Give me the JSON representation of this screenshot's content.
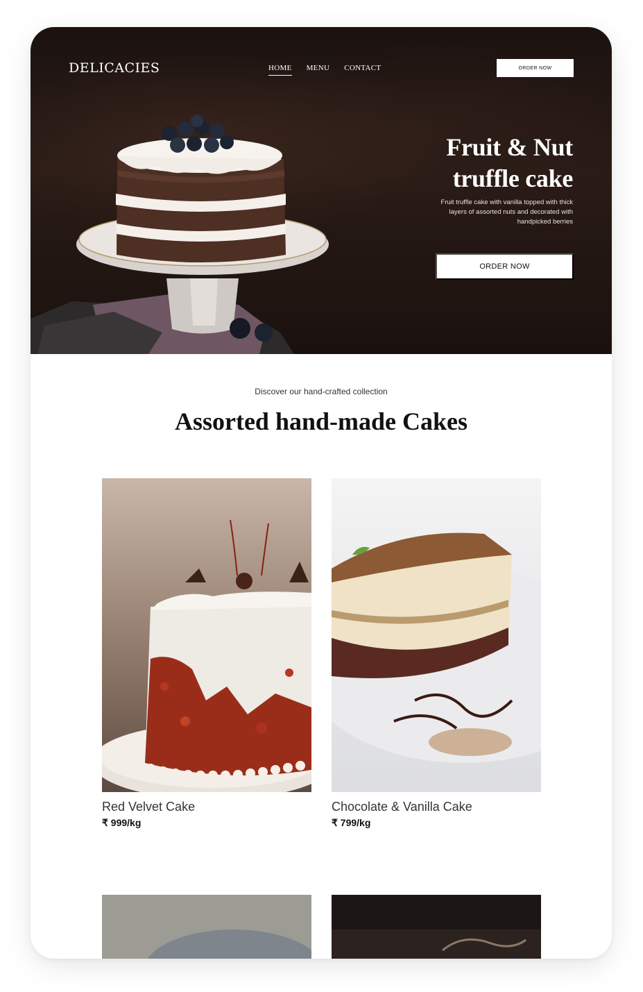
{
  "brand": {
    "logo": "DELICACIES"
  },
  "nav": {
    "items": [
      {
        "label": "HOME",
        "active": true
      },
      {
        "label": "MENU",
        "active": false
      },
      {
        "label": "CONTACT",
        "active": false
      }
    ],
    "order_button": "ORDER NOW"
  },
  "hero": {
    "title_line1": "Fruit & Nut",
    "title_line2": "truffle cake",
    "description": "Fruit truffle cake with vanilla topped with thick layers of assorted nuts and decorated with handpicked berries",
    "order_button": "ORDER NOW"
  },
  "collection": {
    "eyebrow": "Discover our hand-crafted collection",
    "title": "Assorted hand-made Cakes",
    "products": [
      {
        "name": "Red Velvet Cake",
        "price": "₹ 999/kg"
      },
      {
        "name": "Chocolate & Vanilla Cake",
        "price": "₹ 799/kg"
      }
    ]
  },
  "colors": {
    "hero_background": "#1f1512",
    "button_background": "#ffffff",
    "text_dark": "#111111"
  }
}
